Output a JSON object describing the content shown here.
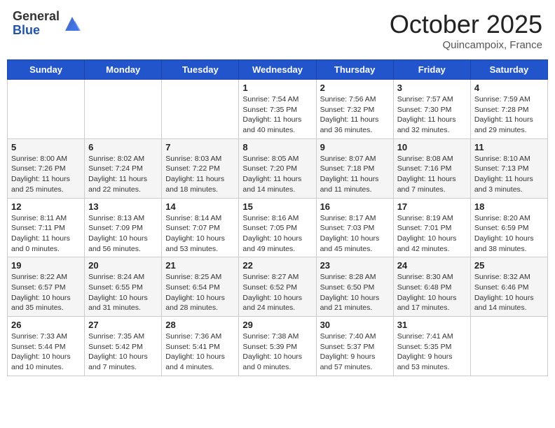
{
  "header": {
    "logo_general": "General",
    "logo_blue": "Blue",
    "month": "October 2025",
    "location": "Quincampoix, France"
  },
  "days_of_week": [
    "Sunday",
    "Monday",
    "Tuesday",
    "Wednesday",
    "Thursday",
    "Friday",
    "Saturday"
  ],
  "weeks": [
    [
      {
        "day": "",
        "info": ""
      },
      {
        "day": "",
        "info": ""
      },
      {
        "day": "",
        "info": ""
      },
      {
        "day": "1",
        "info": "Sunrise: 7:54 AM\nSunset: 7:35 PM\nDaylight: 11 hours and 40 minutes."
      },
      {
        "day": "2",
        "info": "Sunrise: 7:56 AM\nSunset: 7:32 PM\nDaylight: 11 hours and 36 minutes."
      },
      {
        "day": "3",
        "info": "Sunrise: 7:57 AM\nSunset: 7:30 PM\nDaylight: 11 hours and 32 minutes."
      },
      {
        "day": "4",
        "info": "Sunrise: 7:59 AM\nSunset: 7:28 PM\nDaylight: 11 hours and 29 minutes."
      }
    ],
    [
      {
        "day": "5",
        "info": "Sunrise: 8:00 AM\nSunset: 7:26 PM\nDaylight: 11 hours and 25 minutes."
      },
      {
        "day": "6",
        "info": "Sunrise: 8:02 AM\nSunset: 7:24 PM\nDaylight: 11 hours and 22 minutes."
      },
      {
        "day": "7",
        "info": "Sunrise: 8:03 AM\nSunset: 7:22 PM\nDaylight: 11 hours and 18 minutes."
      },
      {
        "day": "8",
        "info": "Sunrise: 8:05 AM\nSunset: 7:20 PM\nDaylight: 11 hours and 14 minutes."
      },
      {
        "day": "9",
        "info": "Sunrise: 8:07 AM\nSunset: 7:18 PM\nDaylight: 11 hours and 11 minutes."
      },
      {
        "day": "10",
        "info": "Sunrise: 8:08 AM\nSunset: 7:16 PM\nDaylight: 11 hours and 7 minutes."
      },
      {
        "day": "11",
        "info": "Sunrise: 8:10 AM\nSunset: 7:13 PM\nDaylight: 11 hours and 3 minutes."
      }
    ],
    [
      {
        "day": "12",
        "info": "Sunrise: 8:11 AM\nSunset: 7:11 PM\nDaylight: 11 hours and 0 minutes."
      },
      {
        "day": "13",
        "info": "Sunrise: 8:13 AM\nSunset: 7:09 PM\nDaylight: 10 hours and 56 minutes."
      },
      {
        "day": "14",
        "info": "Sunrise: 8:14 AM\nSunset: 7:07 PM\nDaylight: 10 hours and 53 minutes."
      },
      {
        "day": "15",
        "info": "Sunrise: 8:16 AM\nSunset: 7:05 PM\nDaylight: 10 hours and 49 minutes."
      },
      {
        "day": "16",
        "info": "Sunrise: 8:17 AM\nSunset: 7:03 PM\nDaylight: 10 hours and 45 minutes."
      },
      {
        "day": "17",
        "info": "Sunrise: 8:19 AM\nSunset: 7:01 PM\nDaylight: 10 hours and 42 minutes."
      },
      {
        "day": "18",
        "info": "Sunrise: 8:20 AM\nSunset: 6:59 PM\nDaylight: 10 hours and 38 minutes."
      }
    ],
    [
      {
        "day": "19",
        "info": "Sunrise: 8:22 AM\nSunset: 6:57 PM\nDaylight: 10 hours and 35 minutes."
      },
      {
        "day": "20",
        "info": "Sunrise: 8:24 AM\nSunset: 6:55 PM\nDaylight: 10 hours and 31 minutes."
      },
      {
        "day": "21",
        "info": "Sunrise: 8:25 AM\nSunset: 6:54 PM\nDaylight: 10 hours and 28 minutes."
      },
      {
        "day": "22",
        "info": "Sunrise: 8:27 AM\nSunset: 6:52 PM\nDaylight: 10 hours and 24 minutes."
      },
      {
        "day": "23",
        "info": "Sunrise: 8:28 AM\nSunset: 6:50 PM\nDaylight: 10 hours and 21 minutes."
      },
      {
        "day": "24",
        "info": "Sunrise: 8:30 AM\nSunset: 6:48 PM\nDaylight: 10 hours and 17 minutes."
      },
      {
        "day": "25",
        "info": "Sunrise: 8:32 AM\nSunset: 6:46 PM\nDaylight: 10 hours and 14 minutes."
      }
    ],
    [
      {
        "day": "26",
        "info": "Sunrise: 7:33 AM\nSunset: 5:44 PM\nDaylight: 10 hours and 10 minutes."
      },
      {
        "day": "27",
        "info": "Sunrise: 7:35 AM\nSunset: 5:42 PM\nDaylight: 10 hours and 7 minutes."
      },
      {
        "day": "28",
        "info": "Sunrise: 7:36 AM\nSunset: 5:41 PM\nDaylight: 10 hours and 4 minutes."
      },
      {
        "day": "29",
        "info": "Sunrise: 7:38 AM\nSunset: 5:39 PM\nDaylight: 10 hours and 0 minutes."
      },
      {
        "day": "30",
        "info": "Sunrise: 7:40 AM\nSunset: 5:37 PM\nDaylight: 9 hours and 57 minutes."
      },
      {
        "day": "31",
        "info": "Sunrise: 7:41 AM\nSunset: 5:35 PM\nDaylight: 9 hours and 53 minutes."
      },
      {
        "day": "",
        "info": ""
      }
    ]
  ]
}
